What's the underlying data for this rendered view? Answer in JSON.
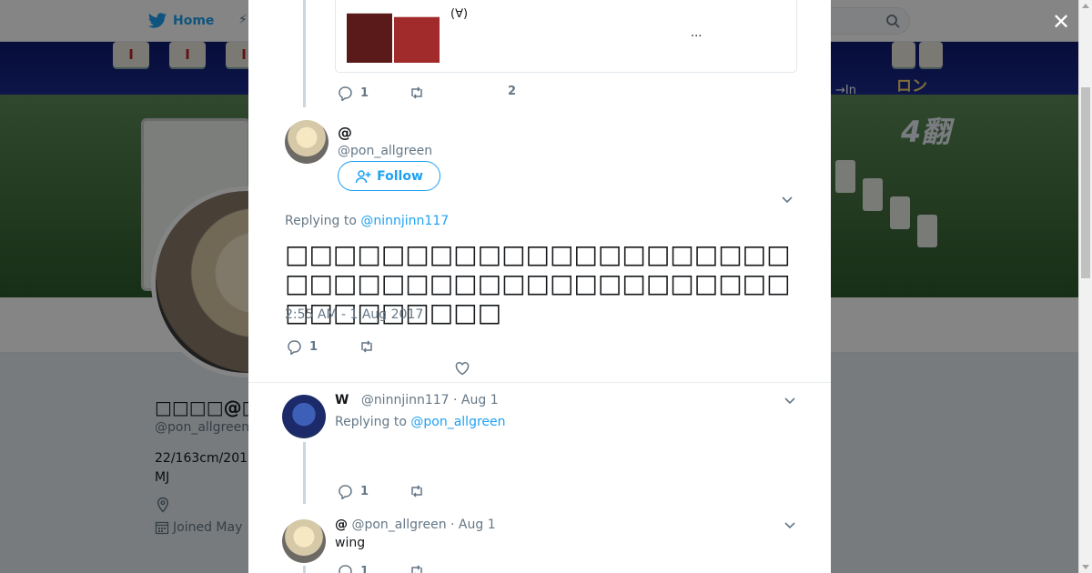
{
  "background": {
    "nav": {
      "home_label": "Home"
    },
    "banner": {
      "tile_glyphs": [
        "Ⅰ",
        "Ⅰ",
        "Ⅰ"
      ],
      "ron_label": "ロン",
      "fan_label": "4翻",
      "lang_label": "→In"
    },
    "profile": {
      "name": "□□□□@□□□",
      "handle": "@pon_allgreen",
      "bio_line1": "22/163cm/201",
      "bio_line2": "MJ",
      "joined": "Joined May"
    }
  },
  "modal": {
    "close_icon": "✕",
    "quote_card": {
      "text": "(∀)",
      "ellipsis": "..."
    },
    "prev_actions": {
      "reply_count": "1",
      "like_count": "2"
    },
    "main_tweet": {
      "name": "@",
      "handle": "@pon_allgreen",
      "follow_label": "Follow",
      "replying_prefix": "Replying to ",
      "replying_to": "@ninnjinn117",
      "text": "□□□□□□□□□□□□□□□□□□□□□□□□□□□□□□□□□□□□□□□□□□□□□□□□□□□",
      "timestamp": "2:55 AM - 1 Aug 2017",
      "reply_count": "1"
    },
    "replies": [
      {
        "name": "W",
        "handle": "@ninnjinn117",
        "date": "· Aug 1",
        "replying_prefix": "Replying to ",
        "replying_to": "@pon_allgreen",
        "text": "",
        "reply_count": "1"
      },
      {
        "name": "@",
        "handle": "@pon_allgreen",
        "date": "· Aug 1",
        "text": "wing",
        "reply_count": "1"
      }
    ]
  }
}
